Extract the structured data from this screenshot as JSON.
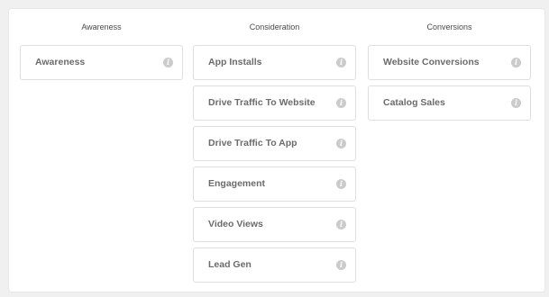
{
  "columns": [
    {
      "header": "Awareness",
      "objectives": [
        {
          "label": "Awareness",
          "icon": "info-icon"
        }
      ]
    },
    {
      "header": "Consideration",
      "objectives": [
        {
          "label": "App Installs",
          "icon": "info-icon"
        },
        {
          "label": "Drive Traffic To Website",
          "icon": "info-icon"
        },
        {
          "label": "Drive Traffic To App",
          "icon": "info-icon"
        },
        {
          "label": "Engagement",
          "icon": "info-icon"
        },
        {
          "label": "Video Views",
          "icon": "info-icon"
        },
        {
          "label": "Lead Gen",
          "icon": "info-icon"
        }
      ]
    },
    {
      "header": "Conversions",
      "objectives": [
        {
          "label": "Website Conversions",
          "icon": "info-icon"
        },
        {
          "label": "Catalog Sales",
          "icon": "info-icon"
        }
      ]
    }
  ],
  "icon_glyph": "i",
  "colors": {
    "background": "#f0f0f0",
    "panel": "#ffffff",
    "card_border": "#dedede",
    "label_text": "#6b6b6b",
    "header_text": "#4a4a4a",
    "info_icon": "#cbcbcb"
  }
}
